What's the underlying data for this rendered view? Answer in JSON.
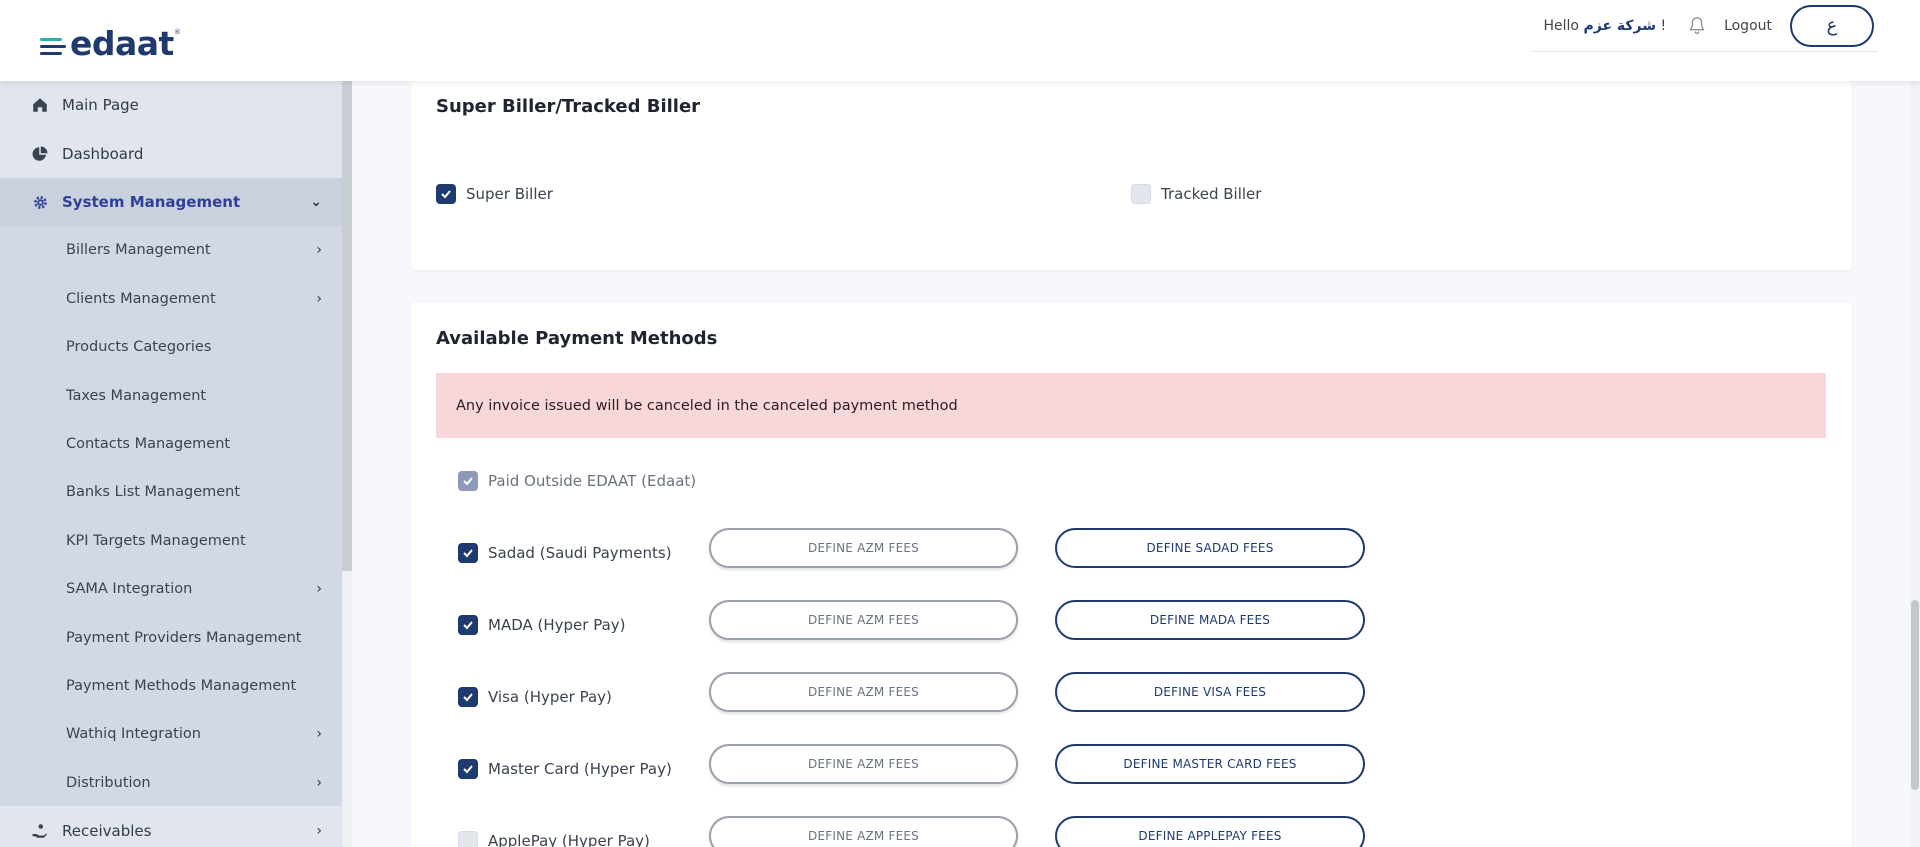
{
  "brand": {
    "name": "edaat",
    "tm": "®",
    "colors": {
      "navy": "#1e3a6e",
      "teal": "#2bb3a3"
    }
  },
  "header": {
    "hello": "Hello",
    "company": "شركة عزم",
    "bang": "!",
    "logout": "Logout",
    "avatar": "ع"
  },
  "sidebar": {
    "top_items": [
      {
        "label": "Main Page",
        "icon": "home-icon"
      },
      {
        "label": "Dashboard",
        "icon": "pie-chart-icon"
      },
      {
        "label": "System Management",
        "icon": "gear-icon"
      }
    ],
    "sub_items": [
      {
        "label": "Billers Management",
        "chevron": true
      },
      {
        "label": "Clients Management",
        "chevron": true
      },
      {
        "label": "Products Categories",
        "chevron": false
      },
      {
        "label": "Taxes Management",
        "chevron": false
      },
      {
        "label": "Contacts Management",
        "chevron": false
      },
      {
        "label": "Banks List Management",
        "chevron": false
      },
      {
        "label": "KPI Targets Management",
        "chevron": false
      },
      {
        "label": "SAMA Integration",
        "chevron": true
      },
      {
        "label": "Payment Providers Management",
        "chevron": false
      },
      {
        "label": "Payment Methods Management",
        "chevron": false
      },
      {
        "label": "Wathiq Integration",
        "chevron": true
      },
      {
        "label": "Distribution",
        "chevron": true
      }
    ],
    "bottom_item": {
      "label": "Receivables",
      "icon": "hand-money-icon"
    }
  },
  "biller_card": {
    "title": "Super Biller/Tracked Biller",
    "super_label": "Super Biller",
    "super_checked": true,
    "tracked_label": "Tracked Biller",
    "tracked_checked": false
  },
  "payment_card": {
    "title": "Available Payment Methods",
    "alert": "Any invoice issued will be canceled in the canceled payment method",
    "outside_label": "Paid Outside EDAAT (Edaat)",
    "azm_label": "DEFINE AZM FEES",
    "methods": [
      {
        "label": "Sadad (Saudi Payments)",
        "checked": true,
        "fees": "DEFINE SADAD FEES"
      },
      {
        "label": "MADA (Hyper Pay)",
        "checked": true,
        "fees": "DEFINE MADA FEES"
      },
      {
        "label": "Visa (Hyper Pay)",
        "checked": true,
        "fees": "DEFINE VISA FEES"
      },
      {
        "label": "Master Card (Hyper Pay)",
        "checked": true,
        "fees": "DEFINE MASTER CARD FEES"
      },
      {
        "label": "ApplePay (Hyper Pay)",
        "checked": false,
        "fees": "DEFINE APPLEPAY FEES"
      }
    ]
  }
}
